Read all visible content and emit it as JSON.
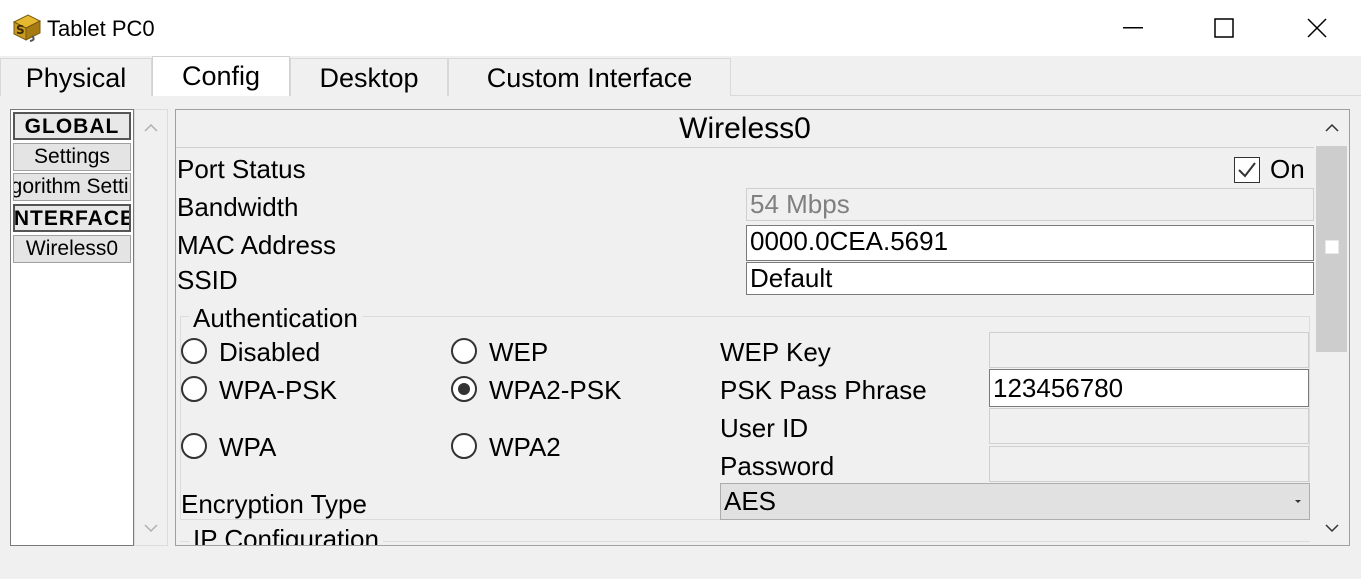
{
  "window": {
    "title": "Tablet PC0",
    "icon": "packet-tracer-app-icon",
    "controls": [
      "minimize-icon",
      "maximize-icon",
      "close-icon"
    ]
  },
  "tabs": [
    {
      "label": "Physical",
      "active": false
    },
    {
      "label": "Config",
      "active": true
    },
    {
      "label": "Desktop",
      "active": false
    },
    {
      "label": "Custom Interface",
      "active": false
    }
  ],
  "sidebar": {
    "items": [
      {
        "label": "GLOBAL",
        "type": "header"
      },
      {
        "label": "Settings",
        "type": "item"
      },
      {
        "label": "Algorithm Settings",
        "type": "item"
      },
      {
        "label": "INTERFACE",
        "type": "header"
      },
      {
        "label": "Wireless0",
        "type": "item"
      }
    ]
  },
  "panel": {
    "title": "Wireless0",
    "port_status_label": "Port Status",
    "port_status_checked": true,
    "port_status_on_label": "On",
    "bandwidth_label": "Bandwidth",
    "bandwidth_value": "54 Mbps",
    "mac_label": "MAC Address",
    "mac_value": "0000.0CEA.5691",
    "ssid_label": "SSID",
    "ssid_value": "Default",
    "auth": {
      "title": "Authentication",
      "options": [
        {
          "label": "Disabled",
          "selected": false
        },
        {
          "label": "WEP",
          "selected": false
        },
        {
          "label": "WPA-PSK",
          "selected": false
        },
        {
          "label": "WPA2-PSK",
          "selected": true
        },
        {
          "label": "WPA",
          "selected": false
        },
        {
          "label": "WPA2",
          "selected": false
        }
      ],
      "wep_key_label": "WEP Key",
      "wep_key_value": "",
      "psk_label": "PSK Pass Phrase",
      "psk_value": "123456780",
      "user_id_label": "User ID",
      "user_id_value": "",
      "password_label": "Password",
      "password_value": ""
    },
    "encryption_label": "Encryption Type",
    "encryption_value": "AES",
    "ip_config_title": "IP Configuration"
  }
}
